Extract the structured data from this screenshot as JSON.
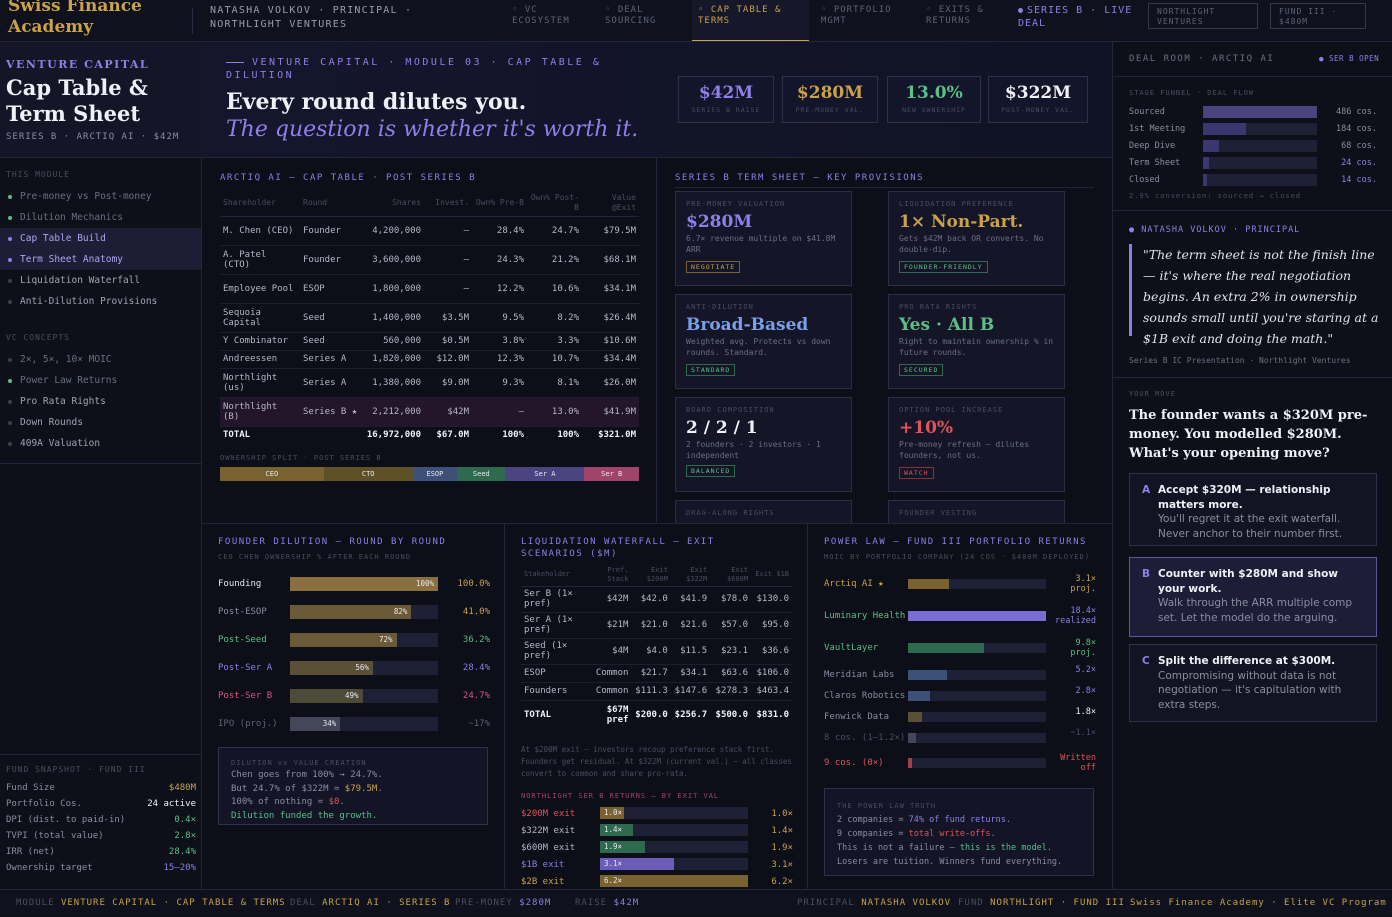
{
  "topbar": {
    "brand": "Swiss Finance Academy",
    "person": "NATASHA VOLKOV · PRINCIPAL · NORTHLIGHT VENTURES",
    "tabs": [
      {
        "label": "◦ VC ECOSYSTEM"
      },
      {
        "label": "◦ DEAL SOURCING"
      },
      {
        "label": "◦ CAP TABLE & TERMS"
      },
      {
        "label": "◦ PORTFOLIO MGMT"
      },
      {
        "label": "◦ EXITS & RETURNS"
      }
    ],
    "live_deal": "SERIES B · LIVE DEAL",
    "pill_fund": "NORTHLIGHT VENTURES",
    "pill_fund3": "FUND III · $480M"
  },
  "sidebar": {
    "kicker": "VENTURE CAPITAL",
    "title": "Cap Table & Term Sheet",
    "subtitle": "SERIES B · ARCTIQ AI · $42M",
    "module_label": "THIS MODULE",
    "module_items": [
      "Pre-money vs Post-money",
      "Dilution Mechanics",
      "Cap Table Build",
      "Term Sheet Anatomy",
      "Liquidation Waterfall",
      "Anti-Dilution Provisions"
    ],
    "concepts_label": "VC CONCEPTS",
    "concept_items": [
      "2×, 5×, 10× MOIC",
      "Power Law Returns",
      "Pro Rata Rights",
      "Down Rounds",
      "409A Valuation"
    ],
    "fund_title": "FUND SNAPSHOT · FUND III",
    "fund_rows": [
      {
        "k": "Fund Size",
        "v": "$480M"
      },
      {
        "k": "Portfolio Cos.",
        "v": "24 active"
      },
      {
        "k": "DPI (dist. to paid-in)",
        "v": "0.4×"
      },
      {
        "k": "TVPI (total value)",
        "v": "2.8×"
      },
      {
        "k": "IRR (net)",
        "v": "28.4%"
      },
      {
        "k": "Ownership target",
        "v": "15–20%"
      }
    ]
  },
  "hero": {
    "kicker": "VENTURE CAPITAL · MODULE 03 · CAP TABLE & DILUTION",
    "headline": "Every round dilutes you.",
    "subline": "The question is whether it's worth it.",
    "kpis": [
      {
        "value": "$42M",
        "label": "SERIES B RAISE"
      },
      {
        "value": "$280M",
        "label": "PRE-MONEY VAL."
      },
      {
        "value": "13.0%",
        "label": "NEW OWNERSHIP"
      },
      {
        "value": "$322M",
        "label": "POST-MONEY VAL."
      }
    ]
  },
  "cap_table": {
    "title": "ARCTIQ AI — CAP TABLE · POST SERIES B",
    "headers": [
      "Shareholder",
      "Round",
      "Shares",
      "Invest.",
      "Own% Pre-B",
      "Own% Post-B",
      "Value @Exit"
    ],
    "rows": [
      {
        "holder": "M. Chen (CEO)",
        "round": "Founder",
        "shares": "4,200,000",
        "invest": "—",
        "pre": "28.4%",
        "post": "24.7%",
        "value": "$79.5M"
      },
      {
        "holder": "A. Patel (CTO)",
        "round": "Founder",
        "shares": "3,600,000",
        "invest": "—",
        "pre": "24.3%",
        "post": "21.2%",
        "value": "$68.1M"
      },
      {
        "holder": "Employee Pool",
        "round": "ESOP",
        "shares": "1,800,000",
        "invest": "—",
        "pre": "12.2%",
        "post": "10.6%",
        "value": "$34.1M"
      },
      {
        "holder": "Sequoia Capital",
        "round": "Seed",
        "shares": "1,400,000",
        "invest": "$3.5M",
        "pre": "9.5%",
        "post": "8.2%",
        "value": "$26.4M"
      },
      {
        "holder": "Y Combinator",
        "round": "Seed",
        "shares": "560,000",
        "invest": "$0.5M",
        "pre": "3.8%",
        "post": "3.3%",
        "value": "$10.6M"
      },
      {
        "holder": "Andreessen",
        "round": "Series A",
        "shares": "1,820,000",
        "invest": "$12.0M",
        "pre": "12.3%",
        "post": "10.7%",
        "value": "$34.4M"
      },
      {
        "holder": "Northlight (us)",
        "round": "Series A",
        "shares": "1,380,000",
        "invest": "$9.0M",
        "pre": "9.3%",
        "post": "8.1%",
        "value": "$26.0M"
      },
      {
        "holder": "Northlight (B)",
        "round": "Series B ★",
        "shares": "2,212,000",
        "invest": "$42M",
        "pre": "—",
        "post": "13.0%",
        "value": "$41.9M"
      }
    ],
    "total": {
      "holder": "TOTAL",
      "round": "",
      "shares": "16,972,000",
      "invest": "$67.0M",
      "pre": "100%",
      "post": "100%",
      "value": "$321.0M"
    },
    "split_label": "OWNERSHIP SPLIT · POST SERIES B",
    "split": [
      {
        "label": "CEO",
        "pct": 24.7,
        "color": "#7a6230"
      },
      {
        "label": "CTO",
        "pct": 21.2,
        "color": "#5e5128"
      },
      {
        "label": "ESOP",
        "pct": 10.6,
        "color": "#3c5078"
      },
      {
        "label": "Seed",
        "pct": 11.5,
        "color": "#2e6a4e"
      },
      {
        "label": "Ser A",
        "pct": 18.8,
        "color": "#4a4580"
      },
      {
        "label": "Ser B",
        "pct": 13.0,
        "color": "#a0446c"
      }
    ]
  },
  "terms": {
    "title": "SERIES B TERM SHEET — KEY PROVISIONS",
    "cards": [
      {
        "label": "PRE-MONEY VALUATION",
        "value": "$280M",
        "desc": "6.7× revenue multiple on $41.8M ARR",
        "tag": "NEGOTIATE"
      },
      {
        "label": "LIQUIDATION PREFERENCE",
        "value": "1× Non-Part.",
        "desc": "Gets $42M back OR converts. No double-dip.",
        "tag": "FOUNDER-FRIENDLY"
      },
      {
        "label": "ANTI-DILUTION",
        "value": "Broad-Based",
        "desc": "Weighted avg. Protects vs down rounds. Standard.",
        "tag": "STANDARD"
      },
      {
        "label": "PRO RATA RIGHTS",
        "value": "Yes · All B",
        "desc": "Right to maintain ownership % in future rounds.",
        "tag": "SECURED"
      },
      {
        "label": "BOARD COMPOSITION",
        "value": "2 / 2 / 1",
        "desc": "2 founders · 2 investors · 1 independent",
        "tag": "BALANCED"
      },
      {
        "label": "OPTION POOL INCREASE",
        "value": "+10%",
        "desc": "Pre-money refresh — dilutes founders, not us.",
        "tag": "WATCH"
      },
      {
        "label": "DRAG-ALONG RIGHTS"
      },
      {
        "label": "FOUNDER VESTING"
      }
    ]
  },
  "dilution": {
    "title": "FOUNDER DILUTION — ROUND BY ROUND",
    "subtitle": "CEO CHEN OWNERSHIP % AFTER EACH ROUND",
    "rows": [
      {
        "label": "Founding",
        "bar": 100,
        "bar_label": "100%",
        "value": "100.0%"
      },
      {
        "label": "Post-ESOP",
        "bar": 82,
        "bar_label": "82%",
        "value": "41.0%"
      },
      {
        "label": "Post-Seed",
        "bar": 72,
        "bar_label": "72%",
        "value": "36.2%"
      },
      {
        "label": "Post-Ser A",
        "bar": 56,
        "bar_label": "56%",
        "value": "28.4%"
      },
      {
        "label": "Post-Ser B",
        "bar": 49,
        "bar_label": "49%",
        "value": "24.7%"
      },
      {
        "label": "IPO (proj.)",
        "bar": 34,
        "bar_label": "34%",
        "value": "~17%"
      }
    ],
    "note_title": "DILUTION vs VALUE CREATION",
    "note_l1": "Chen goes from 100% → 24.7%.",
    "note_l2a": "But 24.7% of $322M = ",
    "note_l2b": "$79.5M",
    "note_l3a": "100% of nothing = ",
    "note_l3b": "$0",
    "note_l4": "Dilution funded the growth."
  },
  "waterfall": {
    "title": "LIQUIDATION WATERFALL — EXIT SCENARIOS ($M)",
    "headers": [
      "Stakeholder",
      "Pref. Stack",
      "Exit $200M",
      "Exit $322M",
      "Exit $600M",
      "Exit $1B"
    ],
    "rows": [
      {
        "name": "Ser B (1× pref)",
        "pref": "$42M",
        "e1": "$42.0",
        "e2": "$41.9",
        "e3": "$78.0",
        "e4": "$130.0"
      },
      {
        "name": "Ser A (1× pref)",
        "pref": "$21M",
        "e1": "$21.0",
        "e2": "$21.6",
        "e3": "$57.0",
        "e4": "$95.0"
      },
      {
        "name": "Seed (1× pref)",
        "pref": "$4M",
        "e1": "$4.0",
        "e2": "$11.5",
        "e3": "$23.1",
        "e4": "$36.6"
      },
      {
        "name": "ESOP",
        "pref": "Common",
        "e1": "$21.7",
        "e2": "$34.1",
        "e3": "$63.6",
        "e4": "$106.0"
      },
      {
        "name": "Founders",
        "pref": "Common",
        "e1": "$111.3",
        "e2": "$147.6",
        "e3": "$278.3",
        "e4": "$463.4"
      }
    ],
    "total": {
      "name": "TOTAL",
      "pref": "$67M pref",
      "e1": "$200.0",
      "e2": "$256.7",
      "e3": "$500.0",
      "e4": "$831.0"
    },
    "note": "At $200M exit — investors recoup preference stack first. Founders get residual. At $322M (current val.) — all classes convert to common and share pro-rata.",
    "returns_title": "NORTHLIGHT SER B RETURNS — BY EXIT VAL",
    "returns": [
      {
        "label": "$200M exit",
        "bar": 1.0,
        "bar_label": "1.0×",
        "value": "1.0×",
        "color": "#7a6230"
      },
      {
        "label": "$322M exit",
        "bar": 1.4,
        "bar_label": "1.4×",
        "value": "1.4×",
        "color": "#2e6a4e"
      },
      {
        "label": "$600M exit",
        "bar": 1.9,
        "bar_label": "1.9×",
        "value": "1.9×",
        "color": "#2e6a4e"
      },
      {
        "label": "$1B exit",
        "bar": 3.1,
        "bar_label": "3.1×",
        "value": "3.1×",
        "color": "#6a5cb8"
      },
      {
        "label": "$2B exit",
        "bar": 6.2,
        "bar_label": "6.2×",
        "value": "6.2×",
        "color": "#7a6230"
      }
    ]
  },
  "powerlaw": {
    "title": "POWER LAW — FUND III PORTFOLIO RETURNS",
    "subtitle": "MOIC BY PORTFOLIO COMPANY (24 COS · $480M DEPLOYED)",
    "rows": [
      {
        "label": "Arctiq AI ★",
        "bar": 30,
        "value": "3.1× proj.",
        "color": "#7a6230"
      },
      {
        "label": "Luminary Health",
        "bar": 100,
        "value": "18.4× realized",
        "color": "#7a6cd0"
      },
      {
        "label": "VaultLayer",
        "bar": 55,
        "value": "9.8× proj.",
        "color": "#2e6a4e"
      },
      {
        "label": "Meridian Labs",
        "bar": 28,
        "value": "5.2×",
        "color": "#3c5078"
      },
      {
        "label": "Claros Robotics",
        "bar": 16,
        "value": "2.8×",
        "color": "#3c5078"
      },
      {
        "label": "Fenwick Data",
        "bar": 10,
        "value": "1.8×",
        "color": "#5a5038"
      },
      {
        "label": "8 cos. (1–1.2×)",
        "bar": 6,
        "value": "~1.1×",
        "color": "#44475a"
      },
      {
        "label": "9 cos. (0×)",
        "bar": 3,
        "value": "Written off",
        "color": "#a0404a"
      }
    ],
    "note_title": "THE POWER LAW TRUTH",
    "note_l1a": "2 companies = ",
    "note_l1b": "74% of fund returns",
    "note_l2a": "9 companies = ",
    "note_l2b": "total write-offs",
    "note_l3a": "This is not a failure — ",
    "note_l3b": "this is the model",
    "note_l4": "Losers are tuition. Winners fund everything."
  },
  "right": {
    "deal_room": "DEAL ROOM · ARCTIQ AI",
    "badge": "● SER B OPEN",
    "funnel_title": "STAGE FUNNEL · DEAL FLOW",
    "funnel": [
      {
        "label": "Sourced",
        "pct": 100,
        "value": "486 cos."
      },
      {
        "label": "1st Meeting",
        "pct": 38,
        "value": "184 cos."
      },
      {
        "label": "Deep Dive",
        "pct": 14,
        "value": "68 cos."
      },
      {
        "label": "Term Sheet",
        "pct": 5,
        "value": "24 cos."
      },
      {
        "label": "Closed",
        "pct": 3,
        "value": "14 cos."
      }
    ],
    "funnel_note": "2.9% conversion: sourced → closed",
    "quote_author": "NATASHA VOLKOV · PRINCIPAL",
    "quote": "\"The term sheet is not the finish line — it's where the real negotiation begins. An extra 2% in ownership sounds small until you're staring at a $1B exit and doing the math.\"",
    "quote_src": "Series B IC Presentation · Northlight Ventures",
    "move_label": "YOUR MOVE",
    "question": "The founder wants a $320M pre-money. You modelled $280M. What's your opening move?",
    "options": [
      {
        "letter": "A",
        "head": "Accept $320M — relationship matters more.",
        "body": "You'll regret it at the exit waterfall. Never anchor to their number first."
      },
      {
        "letter": "B",
        "head": "Counter with $280M and show your work.",
        "body": "Walk through the ARR multiple comp set. Let the model do the arguing."
      },
      {
        "letter": "C",
        "head": "Split the difference at $300M.",
        "body": "Compromising without data is not negotiation — it's capitulation with extra steps."
      }
    ]
  },
  "footer": {
    "module_k": "MODULE",
    "module_v": "VENTURE CAPITAL · CAP TABLE & TERMS",
    "deal_k": "DEAL",
    "deal_v": "ARCTIQ AI · SERIES B",
    "pre_k": "PRE-MONEY",
    "pre_v": "$280M",
    "raise_k": "RAISE",
    "raise_v": "$42M",
    "principal_k": "PRINCIPAL",
    "principal_v": "NATASHA VOLKOV",
    "fund_k": "FUND",
    "fund_v": "NORTHLIGHT · FUND III",
    "academy": "Swiss Finance Academy · Elite VC Program"
  }
}
